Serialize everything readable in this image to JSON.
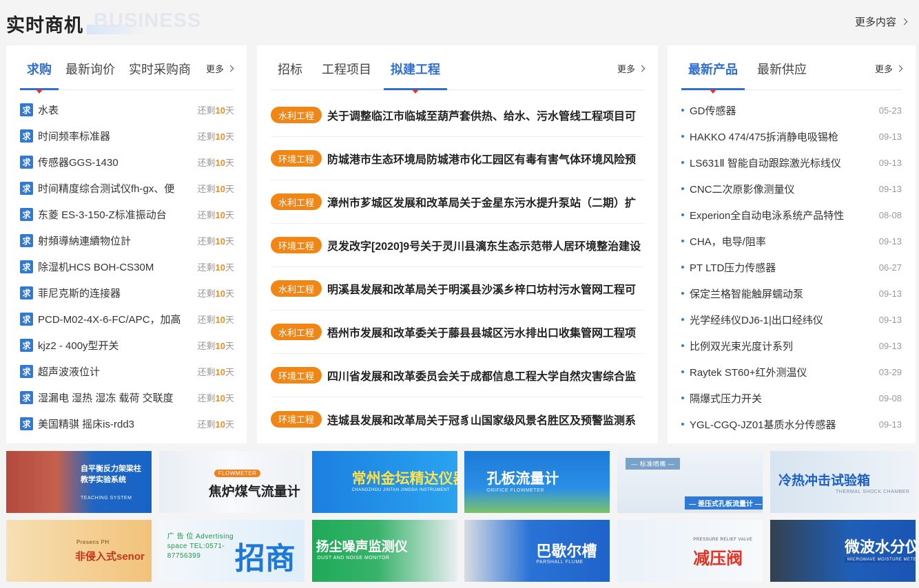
{
  "header": {
    "title_cn": "实时商机",
    "title_en": "BUSINESS",
    "more_label": "更多内容"
  },
  "panel1": {
    "tabs": [
      "求购",
      "最新询价",
      "实时采购商"
    ],
    "active_tab": 0,
    "more_label": "更多",
    "badge": "求",
    "remain_prefix": "还剩",
    "remain_suffix": "天",
    "items": [
      {
        "name": "水表",
        "days": "10"
      },
      {
        "name": "时间频率标准器",
        "days": "10"
      },
      {
        "name": "传感器GGS-1430",
        "days": "10"
      },
      {
        "name": "时间精度综合测试仪fh-gx、便",
        "days": "10"
      },
      {
        "name": "东菱 ES-3-150-Z标准振动台",
        "days": "10"
      },
      {
        "name": "射頻導納連續物位計",
        "days": "10"
      },
      {
        "name": "除湿机HCS BOH-CS30M",
        "days": "10"
      },
      {
        "name": "菲尼克斯的连接器",
        "days": "10"
      },
      {
        "name": "PCD-M02-4X-6-FC/APC，加高",
        "days": "10"
      },
      {
        "name": "kjz2 - 400y型开关",
        "days": "10"
      },
      {
        "name": "超声波液位计",
        "days": "10"
      },
      {
        "name": "湿漏电 湿热 湿冻 载荷 交联度",
        "days": "10"
      },
      {
        "name": "美国精骐 摇床is-rdd3",
        "days": "10"
      }
    ]
  },
  "panel2": {
    "tabs": [
      "招标",
      "工程项目",
      "拟建工程"
    ],
    "active_tab": 2,
    "more_label": "更多",
    "items": [
      {
        "tag": "水利工程",
        "title": "关于调整临江市临城至葫芦套供热、给水、污水管线工程项目可"
      },
      {
        "tag": "环境工程",
        "title": "防城港市生态环境局防城港市化工园区有毒有害气体环境风险预"
      },
      {
        "tag": "水利工程",
        "title": "漳州市芗城区发展和改革局关于金星东污水提升泵站（二期）扩"
      },
      {
        "tag": "环境工程",
        "title": "灵发改字[2020]9号关于灵川县漓东生态示范带人居环境整治建设"
      },
      {
        "tag": "水利工程",
        "title": "明溪县发展和改革局关于明溪县沙溪乡梓口坊村污水管网工程可"
      },
      {
        "tag": "水利工程",
        "title": "梧州市发展和改革委关于藤县县城区污水排出口收集管网工程项"
      },
      {
        "tag": "环境工程",
        "title": "四川省发展和改革委员会关于成都信息工程大学自然灾害综合监"
      },
      {
        "tag": "环境工程",
        "title": "连城县发展和改革局关于冠豸山国家级风景名胜区及预警监测系"
      }
    ]
  },
  "panel3": {
    "tabs": [
      "最新产品",
      "最新供应"
    ],
    "active_tab": 0,
    "more_label": "更多",
    "items": [
      {
        "name": "GD传感器",
        "date": "05-23"
      },
      {
        "name": "HAKKO 474/475拆消静电吸锡枪",
        "date": "09-13"
      },
      {
        "name": "LS631Ⅱ 智能自动跟踪激光标线仪",
        "date": "09-13"
      },
      {
        "name": "CNC二次原影像测量仪",
        "date": "09-13"
      },
      {
        "name": "Experion全自动电泳系统产品特性",
        "date": "08-08"
      },
      {
        "name": "CHA，电导/阻率",
        "date": "09-13"
      },
      {
        "name": "PT LTD压力传感器",
        "date": "06-27"
      },
      {
        "name": "保定兰格智能触屏蠕动泵",
        "date": "09-13"
      },
      {
        "name": "光学经纬仪DJ6-1|出口经纬仪",
        "date": "09-13"
      },
      {
        "name": "比例双光束光度计系列",
        "date": "09-13"
      },
      {
        "name": "Raytek ST60+红外测温仪",
        "date": "03-29"
      },
      {
        "name": "隔爆式压力开关",
        "date": "09-08"
      },
      {
        "name": "YGL-CGQ-JZ01基质水分传感器",
        "date": "09-13"
      }
    ]
  },
  "banners": [
    {
      "text": "自平衡反力架梁柱\n教学实验系统",
      "sub": "TEACHING SYSTEM",
      "color": "#ffffff"
    },
    {
      "text": "焦炉煤气流量计",
      "sub": "FLOWMETER",
      "color": "#222222"
    },
    {
      "text": "常州金坛精达仪器",
      "sub": "CHANGZHOU JINTAN JINGDA INSTRUMENT",
      "color": "#ffe14a"
    },
    {
      "text": "孔板流量计",
      "sub": "ORIFICE FLOWMETER",
      "color": "#ffffff"
    },
    {
      "text": "— 差压式孔板流量计 —",
      "sub": "— 标准喷嘴 —",
      "color": "#ffffff"
    },
    {
      "text": "冷热冲击试验箱",
      "sub": "THERMAL SHOCK CHAMBER",
      "color": "#1a5fc6"
    },
    {
      "text": "非侵入式senor",
      "sub": "Presens PH",
      "color": "#c2351b"
    },
    {
      "text": "招商",
      "sub": "广 告 位  Advertising space  TEL:0571-87756399",
      "color": "#1e78d8"
    },
    {
      "text": "扬尘噪声监测仪",
      "sub": "DUST AND NOISE MONITOR",
      "color": "#ffffff"
    },
    {
      "text": "巴歇尔槽",
      "sub": "PARSHALL FLUME",
      "color": "#ffffff"
    },
    {
      "text": "减压阀",
      "sub": "PRESSURE RELIEF VALVE",
      "color": "#e53222"
    },
    {
      "text": "微波水分仪",
      "sub": "MICROWAVE MOISTURE METER",
      "color": "#ffffff"
    }
  ]
}
